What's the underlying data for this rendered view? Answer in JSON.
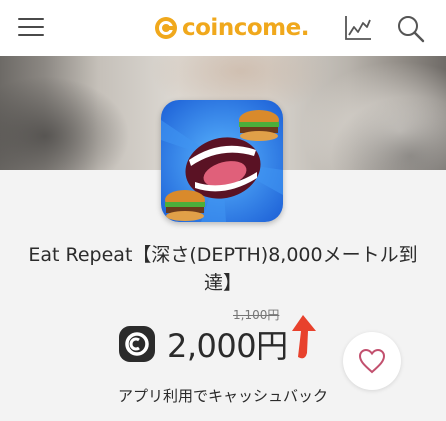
{
  "header": {
    "logo_text": "coincome.",
    "menu_icon": "hamburger-menu-icon",
    "chart_icon": "line-chart-icon",
    "search_icon": "search-icon",
    "brand_color": "#f0a81c"
  },
  "app": {
    "icon": "eat-repeat-app-icon",
    "title": "Eat Repeat【深さ(DEPTH)8,000メートル到達】",
    "price_old": "1,100円",
    "price_new": "2,000円",
    "coin_icon": "coin-icon",
    "trend_icon": "up-arrow-icon",
    "trend_color": "#e8412c",
    "favorite_icon": "heart-icon",
    "favorite_color": "#c2506e",
    "cashback_label": "アプリ利用でキャッシュバック"
  }
}
